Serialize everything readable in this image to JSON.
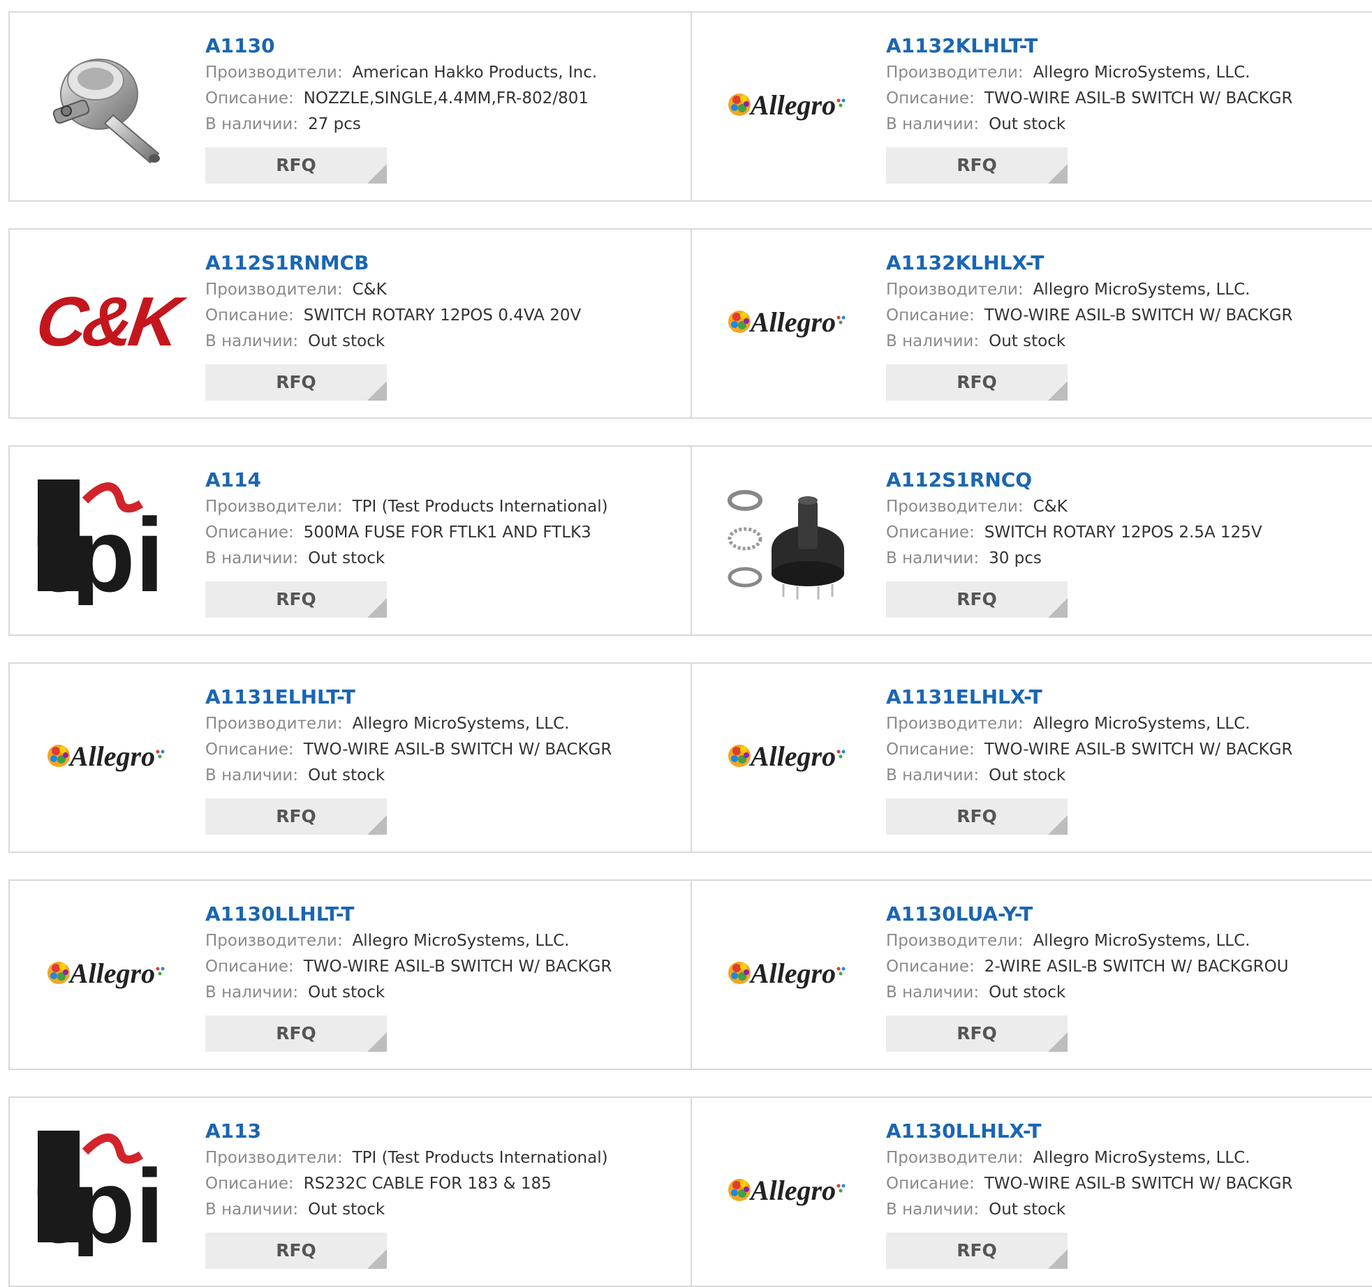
{
  "labels": {
    "manufacturer": "Производители:",
    "description": "Описание:",
    "stock": "В наличии:",
    "rfq": "RFQ"
  },
  "products": [
    {
      "pn": "A1130",
      "manufacturer": "American Hakko Products, Inc.",
      "description": "NOZZLE,SINGLE,4.4MM,FR-802/801",
      "stock": "27 pcs",
      "image": "nozzle-image"
    },
    {
      "pn": "A1132KLHLT-T",
      "manufacturer": "Allegro MicroSystems, LLC.",
      "description": "TWO-WIRE ASIL-B SWITCH W/ BACKGR",
      "stock": "Out stock",
      "image": "allegro-logo"
    },
    {
      "pn": "A112S1RNMCB",
      "manufacturer": "C&K",
      "description": "SWITCH ROTARY 12POS 0.4VA 20V",
      "stock": "Out stock",
      "image": "ck-logo"
    },
    {
      "pn": "A1132KLHLX-T",
      "manufacturer": "Allegro MicroSystems, LLC.",
      "description": "TWO-WIRE ASIL-B SWITCH W/ BACKGR",
      "stock": "Out stock",
      "image": "allegro-logo"
    },
    {
      "pn": "A114",
      "manufacturer": "TPI (Test Products International)",
      "description": "500MA FUSE FOR FTLK1 AND FTLK3",
      "stock": "Out stock",
      "image": "tpi-logo"
    },
    {
      "pn": "A112S1RNCQ",
      "manufacturer": "C&K",
      "description": "SWITCH ROTARY 12POS 2.5A 125V",
      "stock": "30 pcs",
      "image": "rotary-switch-image"
    },
    {
      "pn": "A1131ELHLT-T",
      "manufacturer": "Allegro MicroSystems, LLC.",
      "description": "TWO-WIRE ASIL-B SWITCH W/ BACKGR",
      "stock": "Out stock",
      "image": "allegro-logo"
    },
    {
      "pn": "A1131ELHLX-T",
      "manufacturer": "Allegro MicroSystems, LLC.",
      "description": "TWO-WIRE ASIL-B SWITCH W/ BACKGR",
      "stock": "Out stock",
      "image": "allegro-logo"
    },
    {
      "pn": "A1130LLHLT-T",
      "manufacturer": "Allegro MicroSystems, LLC.",
      "description": "TWO-WIRE ASIL-B SWITCH W/ BACKGR",
      "stock": "Out stock",
      "image": "allegro-logo"
    },
    {
      "pn": "A1130LUA-Y-T",
      "manufacturer": "Allegro MicroSystems, LLC.",
      "description": "2-WIRE ASIL-B SWITCH W/ BACKGROU",
      "stock": "Out stock",
      "image": "allegro-logo"
    },
    {
      "pn": "A113",
      "manufacturer": "TPI (Test Products International)",
      "description": "RS232C CABLE FOR 183 & 185",
      "stock": "Out stock",
      "image": "tpi-logo"
    },
    {
      "pn": "A1130LLHLX-T",
      "manufacturer": "Allegro MicroSystems, LLC.",
      "description": "TWO-WIRE ASIL-B SWITCH W/ BACKGR",
      "stock": "Out stock",
      "image": "allegro-logo"
    }
  ],
  "colors": {
    "link": "#1a66b3",
    "label": "#8a8a8a",
    "value": "#333333",
    "button_bg": "#ececec",
    "border": "#d9d9d9"
  },
  "logo_text": {
    "ck": "C&K",
    "tpi": "tpi",
    "allegro": "Allegro"
  }
}
